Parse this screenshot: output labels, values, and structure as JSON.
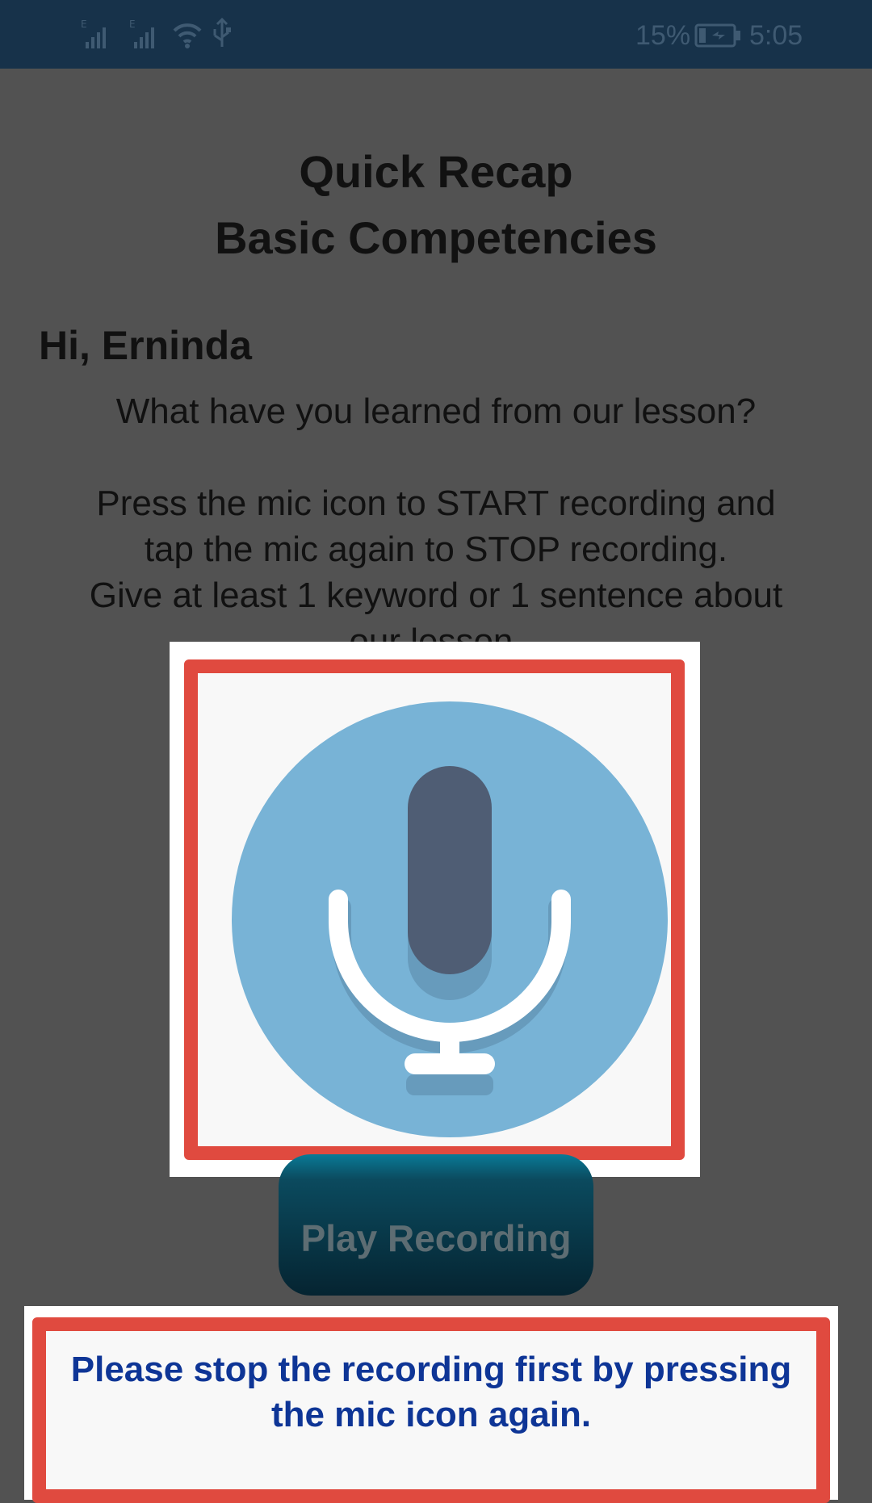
{
  "status_bar": {
    "battery_percent": "15%",
    "time": "5:05",
    "icons": [
      "signal-e-icon",
      "signal-e-icon",
      "wifi-icon",
      "usb-icon",
      "battery-charging-icon"
    ]
  },
  "title": {
    "line1": "Quick Recap",
    "line2": "Basic Competencies"
  },
  "greeting": "Hi, Erninda",
  "question": "What have you learned from our lesson?",
  "instructions": {
    "line1": "Press the mic icon to START recording and",
    "line2": "tap the mic again to STOP recording.",
    "line3": "Give at least 1 keyword or 1 sentence about",
    "line4": "our lesson."
  },
  "mic_button": {
    "icon": "microphone-icon"
  },
  "play_button": {
    "label": "Play Recording"
  },
  "toast": {
    "line1": "Please stop the recording first by pressing",
    "line2": "the mic icon again."
  },
  "colors": {
    "background": "#525252",
    "status_bar": "#17324a",
    "highlight_border": "#e04a3f",
    "mic_circle": "#78b3d6",
    "mic_body": "#4f5d74",
    "toast_text": "#0e3596"
  }
}
